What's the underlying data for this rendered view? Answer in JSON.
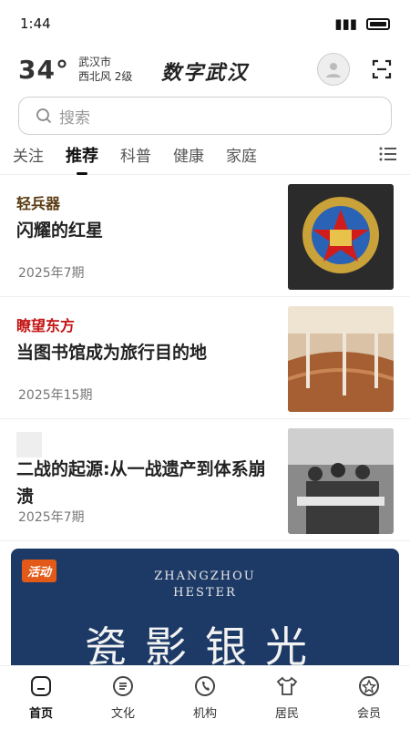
{
  "status_bar": {
    "time": "1:44"
  },
  "header": {
    "temperature": "34°",
    "city": "武汉市",
    "wind": "西北风  2级",
    "brand": "数字武汉"
  },
  "search": {
    "placeholder": "搜索"
  },
  "tabs": [
    "关注",
    "推荐",
    "科普",
    "健康",
    "家庭"
  ],
  "articles": [
    {
      "source": "轻兵器",
      "source_color": "#5a3b10",
      "title": "闪耀的红星",
      "date": "2025年7期"
    },
    {
      "source": "瞭望东方",
      "source_color": "#c41414",
      "title": "当图书馆成为旅行目的地",
      "date": "2025年15期"
    },
    {
      "source": "",
      "title": "二战的起源:从一战遗产到体系崩溃",
      "date": "2025年7期"
    }
  ],
  "banner": {
    "tag": "活动",
    "english_line1": "ZHANGZHOU",
    "english_line2": "HESTER",
    "chinese": "瓷影银光"
  },
  "bottom_nav": [
    "首页",
    "文化",
    "机构",
    "居民",
    "会员"
  ]
}
